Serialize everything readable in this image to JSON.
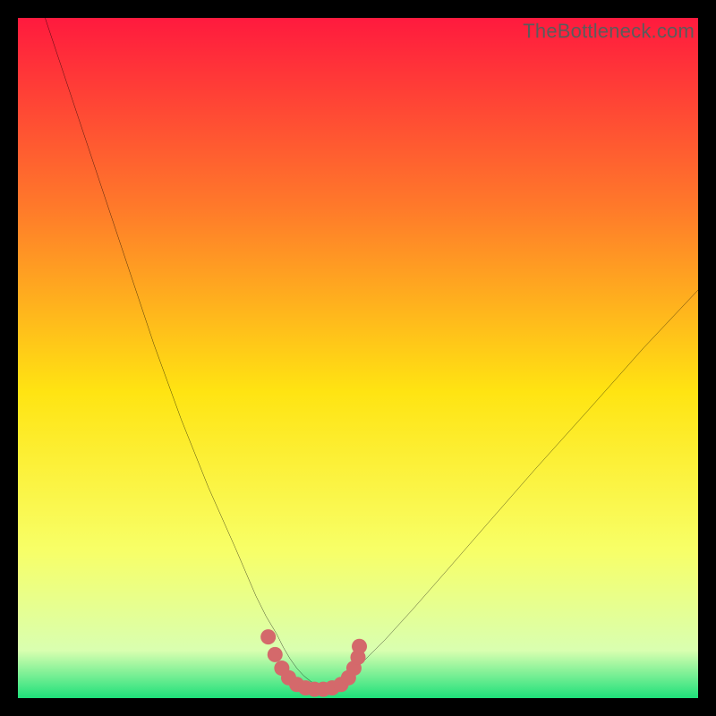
{
  "watermark": "TheBottleneck.com",
  "chart_data": {
    "type": "line",
    "title": "",
    "xlabel": "",
    "ylabel": "",
    "xlim": [
      0,
      100
    ],
    "ylim": [
      0,
      100
    ],
    "gradient_colors": {
      "top": "#ff1a3e",
      "upper_mid": "#ff7a2a",
      "mid": "#ffe412",
      "lower_mid": "#f8ff66",
      "near_bottom": "#d9ffb0",
      "bottom": "#1ee07a"
    },
    "series": [
      {
        "name": "bottleneck-curve",
        "color": "#000000",
        "x": [
          4,
          6,
          8,
          10,
          12,
          14,
          16,
          18,
          20,
          22,
          24,
          26,
          28,
          30,
          32,
          33.5,
          35,
          36.5,
          38,
          39,
          40,
          41,
          42,
          43,
          44,
          45,
          46,
          47.5,
          49,
          51,
          54,
          58,
          63,
          69,
          76,
          84,
          92,
          100
        ],
        "y": [
          100,
          94,
          88,
          82,
          76,
          70,
          64,
          58,
          52,
          46.5,
          41,
          36,
          31,
          26.5,
          22,
          18.5,
          15,
          12,
          9.5,
          7.5,
          5.8,
          4.4,
          3.3,
          2.5,
          1.8,
          1.4,
          1.6,
          2.4,
          3.7,
          5.6,
          8.6,
          13.0,
          18.7,
          25.6,
          33.6,
          42.5,
          51.5,
          60.0
        ]
      }
    ],
    "dotted_band": {
      "name": "optimal-region-dots",
      "color": "#d4696b",
      "radius": 1.12,
      "points": [
        {
          "x": 36.8,
          "y": 9.0
        },
        {
          "x": 37.8,
          "y": 6.4
        },
        {
          "x": 38.8,
          "y": 4.4
        },
        {
          "x": 39.8,
          "y": 3.0
        },
        {
          "x": 41.0,
          "y": 2.0
        },
        {
          "x": 42.3,
          "y": 1.5
        },
        {
          "x": 43.6,
          "y": 1.3
        },
        {
          "x": 44.9,
          "y": 1.3
        },
        {
          "x": 46.2,
          "y": 1.5
        },
        {
          "x": 47.5,
          "y": 2.0
        },
        {
          "x": 48.6,
          "y": 3.0
        },
        {
          "x": 49.4,
          "y": 4.4
        },
        {
          "x": 50.0,
          "y": 6.0
        },
        {
          "x": 50.2,
          "y": 7.6
        }
      ]
    }
  }
}
